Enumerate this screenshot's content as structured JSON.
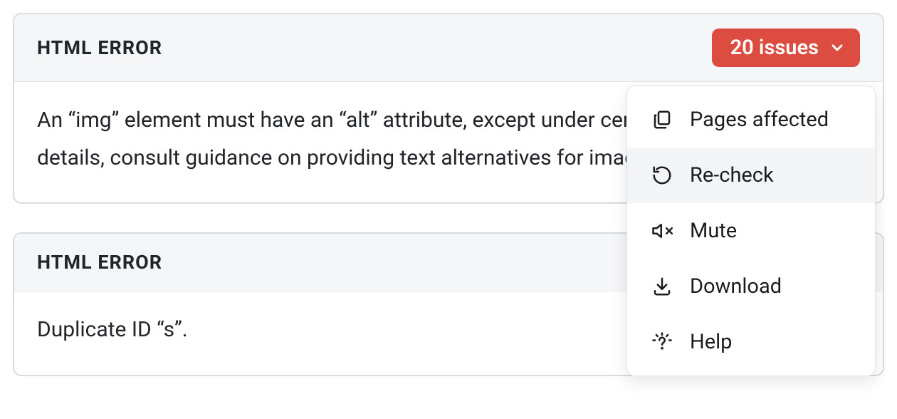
{
  "card1": {
    "title": "HTML ERROR",
    "badge_label": "20 issues",
    "description": "An “img” element must have an “alt” attribute, except under certain conditions. For details, consult guidance on providing text alternatives for images."
  },
  "dropdown": {
    "items": [
      {
        "label": "Pages affected",
        "icon": "copy-icon",
        "hovered": false
      },
      {
        "label": "Re-check",
        "icon": "recheck-icon",
        "hovered": true
      },
      {
        "label": "Mute",
        "icon": "mute-icon",
        "hovered": false
      },
      {
        "label": "Download",
        "icon": "download-icon",
        "hovered": false
      },
      {
        "label": "Help",
        "icon": "help-icon",
        "hovered": false
      }
    ]
  },
  "card2": {
    "title": "HTML ERROR",
    "description": "Duplicate ID “s”."
  }
}
